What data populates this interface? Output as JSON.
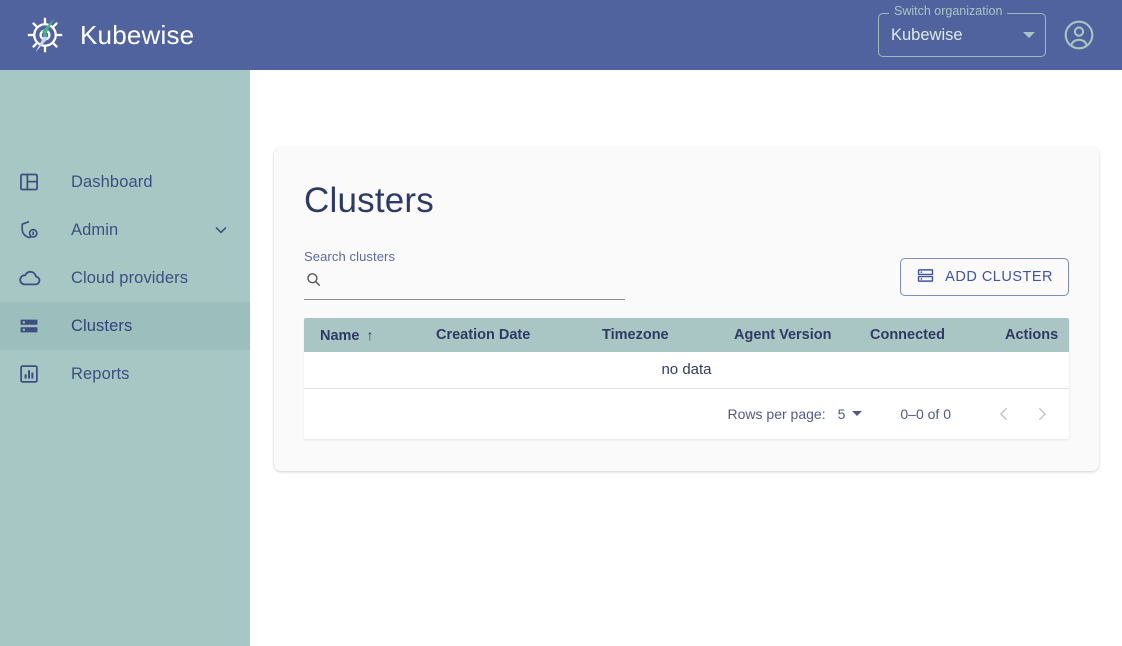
{
  "appbar": {
    "brand_name": "Kubewise",
    "logo_icon": "compass-helm-logo",
    "org_switcher": {
      "legend": "Switch organization",
      "value": "Kubewise",
      "caret_icon": "chevron-down-icon"
    },
    "account_icon": "account-circle-icon"
  },
  "sidebar": {
    "items": [
      {
        "label": "Dashboard",
        "icon": "dashboard-icon",
        "selected": false,
        "expandable": false
      },
      {
        "label": "Admin",
        "icon": "shield-admin-icon",
        "selected": false,
        "expandable": true,
        "chevron": "chevron-down-icon"
      },
      {
        "label": "Cloud providers",
        "icon": "cloud-icon",
        "selected": false,
        "expandable": false
      },
      {
        "label": "Clusters",
        "icon": "storage-icon",
        "selected": true,
        "expandable": false
      },
      {
        "label": "Reports",
        "icon": "assessment-icon",
        "selected": false,
        "expandable": false
      }
    ]
  },
  "main": {
    "title": "Clusters",
    "search": {
      "label": "Search clusters",
      "value": "",
      "placeholder": "",
      "icon": "search-icon"
    },
    "add_button": {
      "label": "ADD CLUSTER",
      "icon": "storage-icon"
    },
    "table": {
      "columns": [
        {
          "label": "Name",
          "sorted": true,
          "sort_icon": "arrow-upward-icon"
        },
        {
          "label": "Creation Date",
          "sorted": false
        },
        {
          "label": "Timezone",
          "sorted": false
        },
        {
          "label": "Agent Version",
          "sorted": false
        },
        {
          "label": "Connected",
          "sorted": false
        },
        {
          "label": "Actions",
          "sorted": false
        }
      ],
      "rows": [],
      "empty_message": "no data"
    },
    "pagination": {
      "rows_per_page_label": "Rows per page:",
      "rows_per_page_value": "5",
      "caret_icon": "chevron-down-icon",
      "range_text": "0–0 of 0",
      "prev_icon": "chevron-left-icon",
      "next_icon": "chevron-right-icon"
    }
  },
  "colors": {
    "appbar": "#51639e",
    "sidebar": "#a6c7c4",
    "sidebar_selected": "#9cbfbd",
    "table_header": "#aac6c4",
    "accent_text": "#2e3a63"
  }
}
